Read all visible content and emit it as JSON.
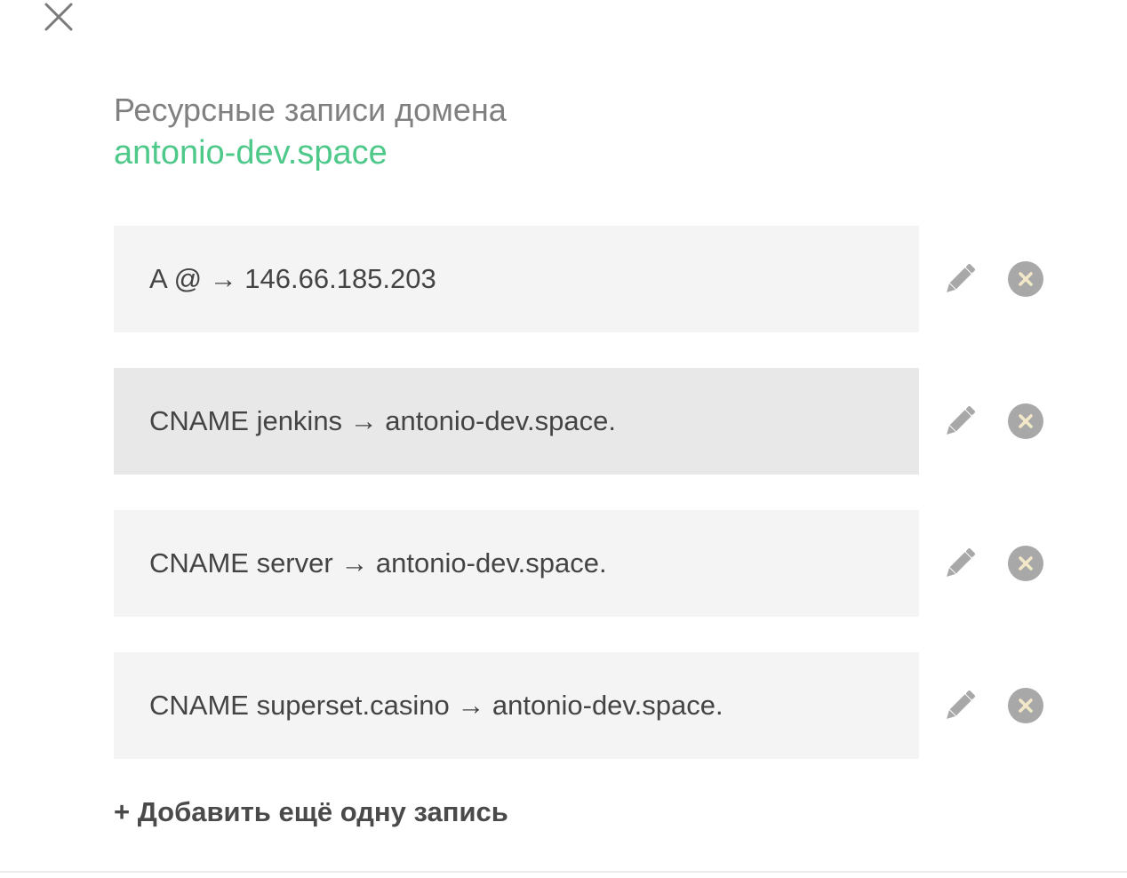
{
  "dialog": {
    "close_icon": "close-icon",
    "title": "Ресурсные записи домена",
    "domain": "antonio-dev.space"
  },
  "records": [
    {
      "text": "A @ → 146.66.185.203",
      "hovered": false
    },
    {
      "text": "CNAME jenkins → antonio-dev.space.",
      "hovered": true
    },
    {
      "text": "CNAME server → antonio-dev.space.",
      "hovered": false
    },
    {
      "text": "CNAME superset.casino → antonio-dev.space.",
      "hovered": false
    }
  ],
  "record_actions": {
    "edit_icon": "pencil-icon",
    "delete_icon": "remove-circle-icon"
  },
  "add_link": {
    "label": "+ Добавить ещё одну запись"
  },
  "colors": {
    "accent": "#4ec98a",
    "record_bg": "#f4f4f4",
    "record_bg_hover": "#e8e8e8",
    "icon_gray": "#a8a8a8",
    "delete_x": "#f3e8c8"
  }
}
